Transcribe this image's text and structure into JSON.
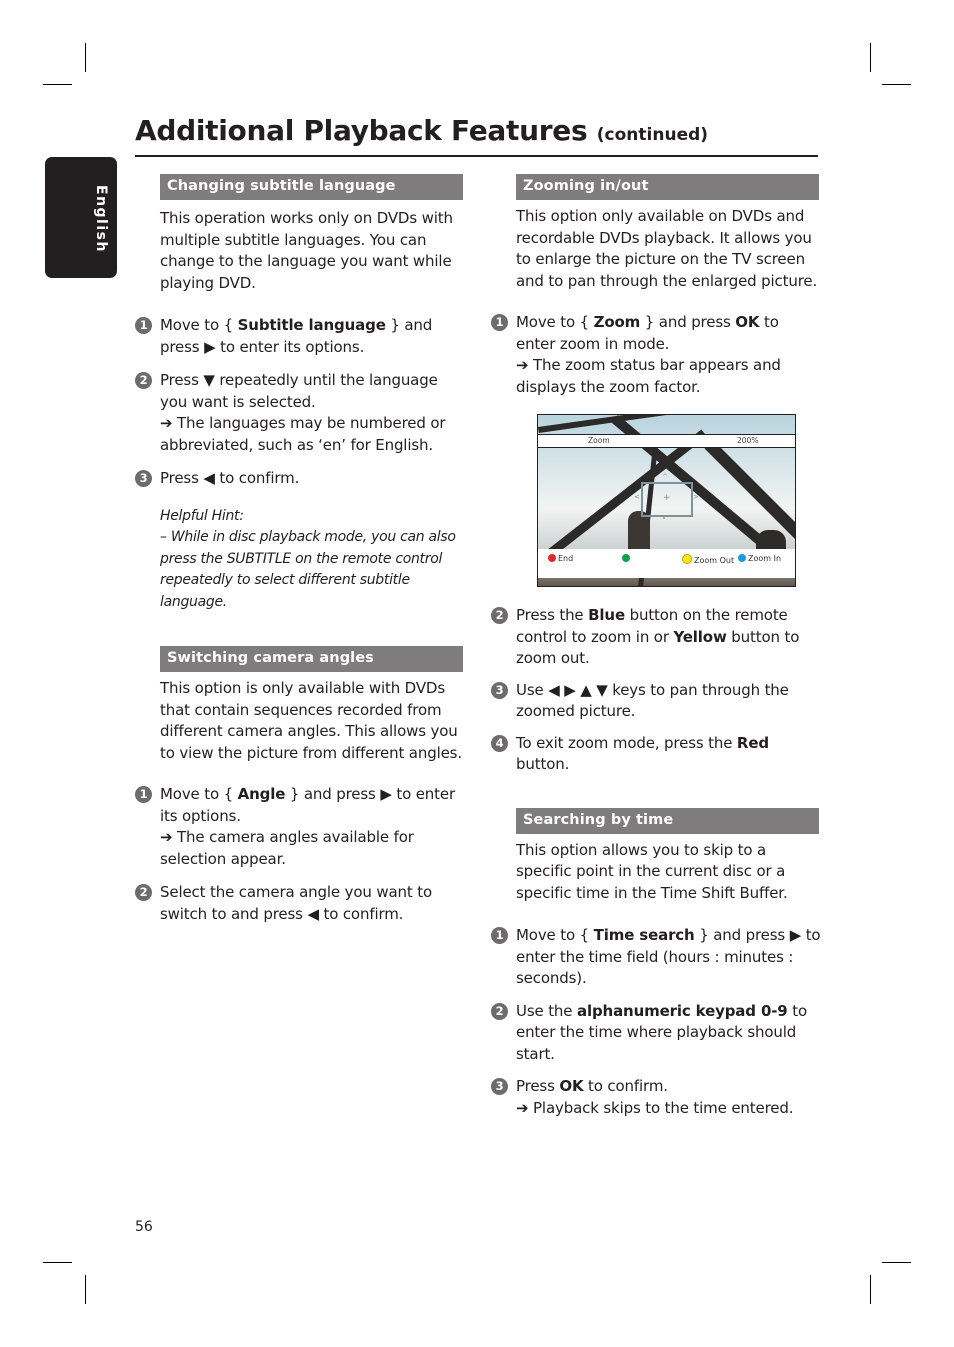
{
  "page": {
    "title": "Additional Playback Features",
    "title_suffix": "(continued)",
    "language_tab": "English",
    "page_number": "56"
  },
  "colors": {
    "text": "#231f20",
    "section_header_bg": "#7e7c7c",
    "step_badge": "#6d6b6b",
    "red_button": "#e0262f",
    "green_button": "#12a04a",
    "yellow_button": "#f6e51a",
    "blue_button": "#1d9ad8"
  },
  "sections": {
    "subtitle": {
      "heading": "Changing subtitle language",
      "intro": "This operation works only on DVDs with multiple subtitle languages. You can change to the language you want while playing DVD.",
      "steps": [
        {
          "num": "1",
          "pre": "Move to { ",
          "bold": "Subtitle language",
          "post": " } and press ▶ to enter its options."
        },
        {
          "num": "2",
          "text": "Press ▼ repeatedly until the language you want is selected.",
          "result": "➔ The languages may be numbered or abbreviated, such as ‘en’ for English."
        },
        {
          "num": "3",
          "text": "Press ◀ to confirm."
        }
      ],
      "hint_title": "Helpful Hint:",
      "hint_text": "–  While in disc playback mode, you can also press the SUBTITLE on the remote control repeatedly to select different subtitle language."
    },
    "camera": {
      "heading": "Switching camera angles",
      "intro": "This option is only available with DVDs that contain sequences recorded from different camera angles. This allows you to view the picture from different angles.",
      "steps": [
        {
          "num": "1",
          "pre": "Move to { ",
          "bold": "Angle",
          "post": " } and press ▶ to enter its options.",
          "result": "➔ The camera angles available for selection appear."
        },
        {
          "num": "2",
          "text": "Select the camera angle you want to switch to and press ◀ to confirm."
        }
      ]
    },
    "zoom": {
      "heading": "Zooming in/out",
      "intro": "This option only available on DVDs and recordable DVDs playback.  It allows you to enlarge the picture on the TV screen and to pan through the enlarged picture.",
      "steps": [
        {
          "num": "1",
          "pre": "Move to { ",
          "bold": "Zoom",
          "mid": " } and press ",
          "bold2": "OK",
          "post": " to enter zoom in mode.",
          "result": "➔ The zoom status bar appears and displays the zoom factor."
        },
        {
          "num": "2",
          "pre": "Press the ",
          "bold": "Blue",
          "mid": " button on the remote control to zoom in or ",
          "bold2": "Yellow",
          "post": " button to zoom out."
        },
        {
          "num": "3",
          "text": "Use ◀ ▶ ▲ ▼ keys to pan through the zoomed picture."
        },
        {
          "num": "4",
          "pre": "To exit zoom mode, press the ",
          "bold": "Red",
          "post": " button."
        }
      ],
      "figure": {
        "status_label": "Zoom",
        "status_value": "200%",
        "legend": [
          {
            "color": "red",
            "label": "End"
          },
          {
            "color": "green",
            "label": ""
          },
          {
            "color": "yellow",
            "label": "Zoom Out"
          },
          {
            "color": "blue",
            "label": "Zoom In"
          }
        ],
        "pan_up": "^",
        "pan_down": "v",
        "pan_left": "<",
        "pan_right": ">",
        "center": "+"
      }
    },
    "time": {
      "heading": "Searching by time",
      "intro": "This option allows you to skip to a specific point in the current disc or a specific time in the Time Shift Buffer.",
      "steps": [
        {
          "num": "1",
          "pre": "Move to { ",
          "bold": "Time search",
          "post": " } and press ▶ to enter the time field (hours : minutes : seconds)."
        },
        {
          "num": "2",
          "pre": "Use the ",
          "bold": "alphanumeric keypad 0-9",
          "post": " to enter the time where playback should start."
        },
        {
          "num": "3",
          "pre": "Press ",
          "bold": "OK",
          "post": " to confirm.",
          "result": "➔ Playback skips to the time entered."
        }
      ]
    }
  }
}
